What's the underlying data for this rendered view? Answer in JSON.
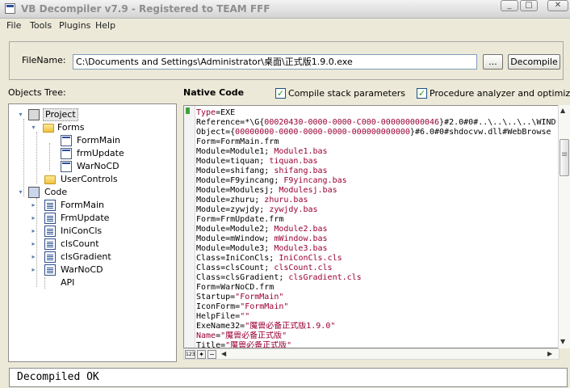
{
  "window": {
    "title": "VB Decompiler v7.9 - Registered to TEAM FFF",
    "controls": {
      "minimize": "_",
      "maximize": "□",
      "close": "✕"
    }
  },
  "menu": [
    "File",
    "Tools",
    "Plugins",
    "Help"
  ],
  "filename": {
    "label": "FileName:",
    "value": "C:\\Documents and Settings\\Administrator\\桌面\\正式版1.9.0.exe",
    "browse_label": "...",
    "decompile_label": "Decompile"
  },
  "objects_tree": {
    "label": "Objects Tree:",
    "items": [
      {
        "label": "Project",
        "icon": "project-icon",
        "expander": "▾"
      },
      {
        "label": "Forms",
        "icon": "folder-icon",
        "expander": "▾"
      },
      {
        "label": "FormMain",
        "icon": "form-icon"
      },
      {
        "label": "frmUpdate",
        "icon": "form-icon"
      },
      {
        "label": "WarNoCD",
        "icon": "form-icon"
      },
      {
        "label": "UserControls",
        "icon": "folder-icon"
      },
      {
        "label": "Code",
        "icon": "code-folder-icon",
        "expander": "▾"
      },
      {
        "label": "FormMain",
        "icon": "code-icon",
        "expander": "▸"
      },
      {
        "label": "FrmUpdate",
        "icon": "code-icon",
        "expander": "▸"
      },
      {
        "label": "IniConCls",
        "icon": "code-icon",
        "expander": "▸"
      },
      {
        "label": "clsCount",
        "icon": "code-icon",
        "expander": "▸"
      },
      {
        "label": "clsGradient",
        "icon": "code-icon",
        "expander": "▸"
      },
      {
        "label": "WarNoCD",
        "icon": "code-icon",
        "expander": "▸"
      },
      {
        "label": "API",
        "icon": "api-icon"
      }
    ]
  },
  "native_code": {
    "label": "Native Code",
    "compile_stack_label": "Compile stack parameters",
    "compile_stack_checked": true,
    "procedure_analyzer_label": "Procedure analyzer and optimizer",
    "procedure_analyzer_checked": true,
    "check_mark": "✓"
  },
  "code_lines": [
    [
      {
        "t": "Type",
        "c": "v"
      },
      {
        "t": "=EXE",
        "c": "k"
      }
    ],
    [
      {
        "t": "Reference=*\\G{",
        "c": "k"
      },
      {
        "t": "00020430-0000-0000-C000-000000000046",
        "c": "v"
      },
      {
        "t": "}#2.0#0#..\\..\\..\\..\\WIND",
        "c": "k"
      }
    ],
    [
      {
        "t": "Object={",
        "c": "k"
      },
      {
        "t": "00000000-0000-0000-0000-000000000000",
        "c": "v"
      },
      {
        "t": "}#6.0#0#shdocvw.dll#WebBrowse",
        "c": "k"
      }
    ],
    [
      {
        "t": "Form=FormMain.frm",
        "c": "k"
      }
    ],
    [
      {
        "t": "Module=Module1; ",
        "c": "k"
      },
      {
        "t": "Module1.bas",
        "c": "v"
      }
    ],
    [
      {
        "t": "Module=tiquan; ",
        "c": "k"
      },
      {
        "t": "tiquan.bas",
        "c": "v"
      }
    ],
    [
      {
        "t": "Module=shifang; ",
        "c": "k"
      },
      {
        "t": "shifang.bas",
        "c": "v"
      }
    ],
    [
      {
        "t": "Module=F9yincang; ",
        "c": "k"
      },
      {
        "t": "F9yincang.bas",
        "c": "v"
      }
    ],
    [
      {
        "t": "Module=Modulesj; ",
        "c": "k"
      },
      {
        "t": "Modulesj.bas",
        "c": "v"
      }
    ],
    [
      {
        "t": "Module=zhuru; ",
        "c": "k"
      },
      {
        "t": "zhuru.bas",
        "c": "v"
      }
    ],
    [
      {
        "t": "Module=zywjdy; ",
        "c": "k"
      },
      {
        "t": "zywjdy.bas",
        "c": "v"
      }
    ],
    [
      {
        "t": "Form=FrmUpdate.frm",
        "c": "k"
      }
    ],
    [
      {
        "t": "Module=Module2; ",
        "c": "k"
      },
      {
        "t": "Module2.bas",
        "c": "v"
      }
    ],
    [
      {
        "t": "Module=mWindow; ",
        "c": "k"
      },
      {
        "t": "mWindow.bas",
        "c": "v"
      }
    ],
    [
      {
        "t": "Module=Module3; ",
        "c": "k"
      },
      {
        "t": "Module3.bas",
        "c": "v"
      }
    ],
    [
      {
        "t": "Class=IniConCls; ",
        "c": "k"
      },
      {
        "t": "IniConCls.cls",
        "c": "v"
      }
    ],
    [
      {
        "t": "Class=clsCount; ",
        "c": "k"
      },
      {
        "t": "clsCount.cls",
        "c": "v"
      }
    ],
    [
      {
        "t": "Class=clsGradient; ",
        "c": "k"
      },
      {
        "t": "clsGradient.cls",
        "c": "v"
      }
    ],
    [
      {
        "t": "Form=WarNoCD.frm",
        "c": "k"
      }
    ],
    [
      {
        "t": "Startup=",
        "c": "k"
      },
      {
        "t": "\"FormMain\"",
        "c": "v"
      }
    ],
    [
      {
        "t": "IconForm=",
        "c": "k"
      },
      {
        "t": "\"FormMain\"",
        "c": "v"
      }
    ],
    [
      {
        "t": "HelpFile=",
        "c": "k"
      },
      {
        "t": "\"\"",
        "c": "v"
      }
    ],
    [
      {
        "t": "ExeName32=",
        "c": "k"
      },
      {
        "t": "\"魔兽必备正式版1.9.0\"",
        "c": "v"
      }
    ],
    [
      {
        "t": "Name",
        "c": "v"
      },
      {
        "t": "=",
        "c": "k"
      },
      {
        "t": "\"魔兽必备正式版\"",
        "c": "v"
      }
    ],
    [
      {
        "t": "Title=",
        "c": "k"
      },
      {
        "t": "\"魔兽必备正式版\"",
        "c": "v"
      }
    ]
  ],
  "bottom_toolbar": {
    "numbers_button": "123",
    "add_button": "✦",
    "remove_button": "−"
  },
  "status": "Decompiled OK"
}
